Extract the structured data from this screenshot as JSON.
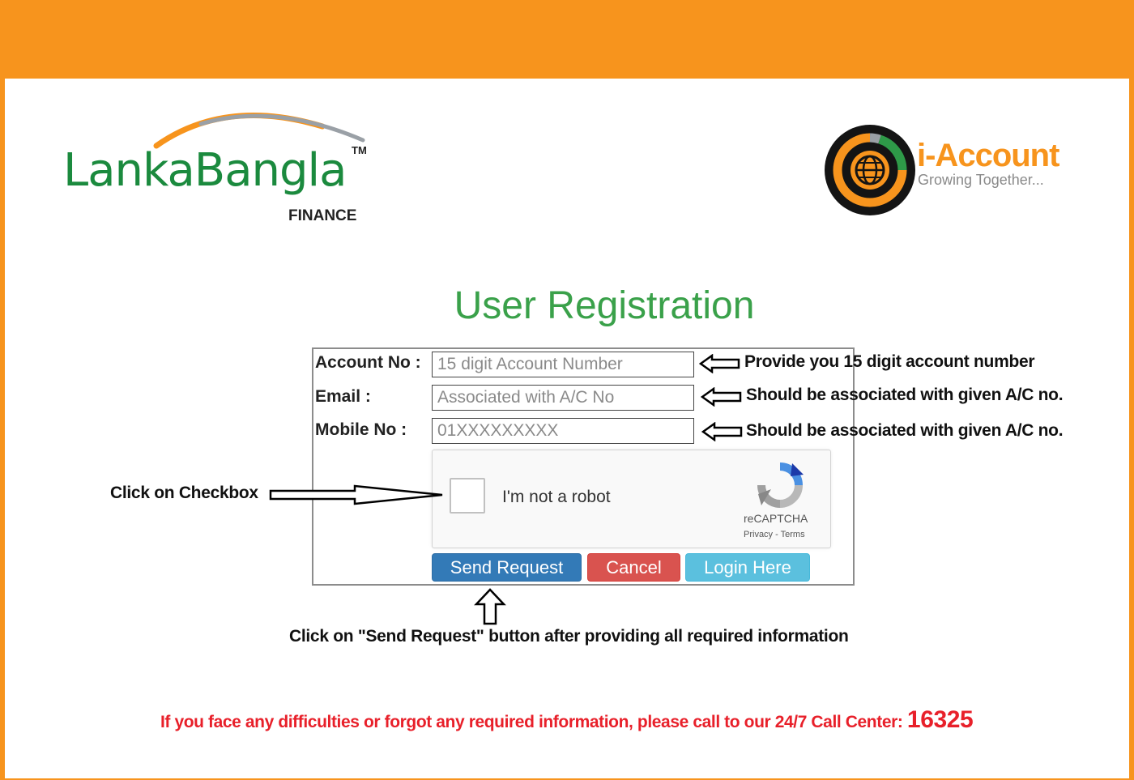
{
  "brand": {
    "name": "LankaBangla",
    "tm": "TM",
    "sub": "FINANCE"
  },
  "app_logo": {
    "title": "i-Account",
    "tagline": "Growing Together..."
  },
  "page": {
    "title": "User Registration"
  },
  "form": {
    "account": {
      "label": "Account No :",
      "placeholder": "15 digit Account Number",
      "value": ""
    },
    "email": {
      "label": "Email :",
      "placeholder": "Associated with A/C No",
      "value": ""
    },
    "mobile": {
      "label": "Mobile No :",
      "placeholder": "01XXXXXXXXX",
      "value": ""
    }
  },
  "recaptcha": {
    "label": "I'm not a robot",
    "brand": "reCAPTCHA",
    "links": "Privacy - Terms"
  },
  "buttons": {
    "send": "Send Request",
    "cancel": "Cancel",
    "login": "Login Here"
  },
  "annotations": {
    "account_hint": "Provide you 15 digit account number",
    "email_hint": "Should be associated with given A/C no.",
    "mobile_hint": "Should be associated with given A/C no.",
    "checkbox_hint": "Click on Checkbox",
    "send_hint": "Click on \"Send Request\" button after providing all required information"
  },
  "footer": {
    "text": "If you face any difficulties or forgot any required information, please call to our 24/7 Call Center: ",
    "number": "16325"
  },
  "colors": {
    "accent_orange": "#f7941d",
    "brand_green": "#1b8a3e",
    "title_green": "#3aa14a",
    "send": "#337ab7",
    "cancel": "#d9534f",
    "login": "#5bc0de",
    "footer_red": "#e8202a"
  },
  "icons": [
    "lankabangla-swoosh-logo",
    "i-account-globe-logo",
    "recaptcha-icon",
    "left-arrow-icon",
    "right-arrow-icon",
    "up-arrow-icon"
  ]
}
